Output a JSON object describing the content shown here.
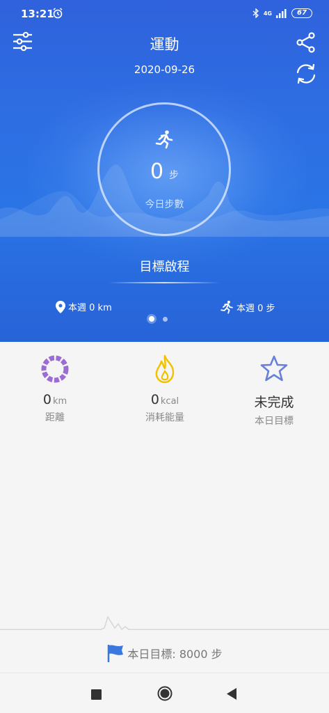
{
  "status": {
    "time": "13:21",
    "network": "4G",
    "battery": "67"
  },
  "header": {
    "title": "運動",
    "date": "2020-09-26"
  },
  "today": {
    "steps": "0",
    "steps_unit": "步",
    "label": "今日步數"
  },
  "journey": {
    "label": "目標啟程"
  },
  "week": {
    "distance": "本週 0 km",
    "steps": "本週 0 步"
  },
  "pager": {
    "pages": 2,
    "active": 0
  },
  "stats": [
    {
      "value": "0",
      "unit": "km",
      "label": "距離",
      "icon": "distance-ring-icon",
      "color": "#9b6bd6"
    },
    {
      "value": "0",
      "unit": "kcal",
      "label": "消耗能量",
      "icon": "flame-icon",
      "color": "#f2c200"
    },
    {
      "value": "未完成",
      "unit": "",
      "label": "本日目標",
      "icon": "star-icon",
      "color": "#6a80d8"
    }
  ],
  "goal": {
    "text": "本日目標: 8000 步"
  },
  "colors": {
    "header_bg": "#2e6ee3",
    "accent": "#3a78e0"
  }
}
